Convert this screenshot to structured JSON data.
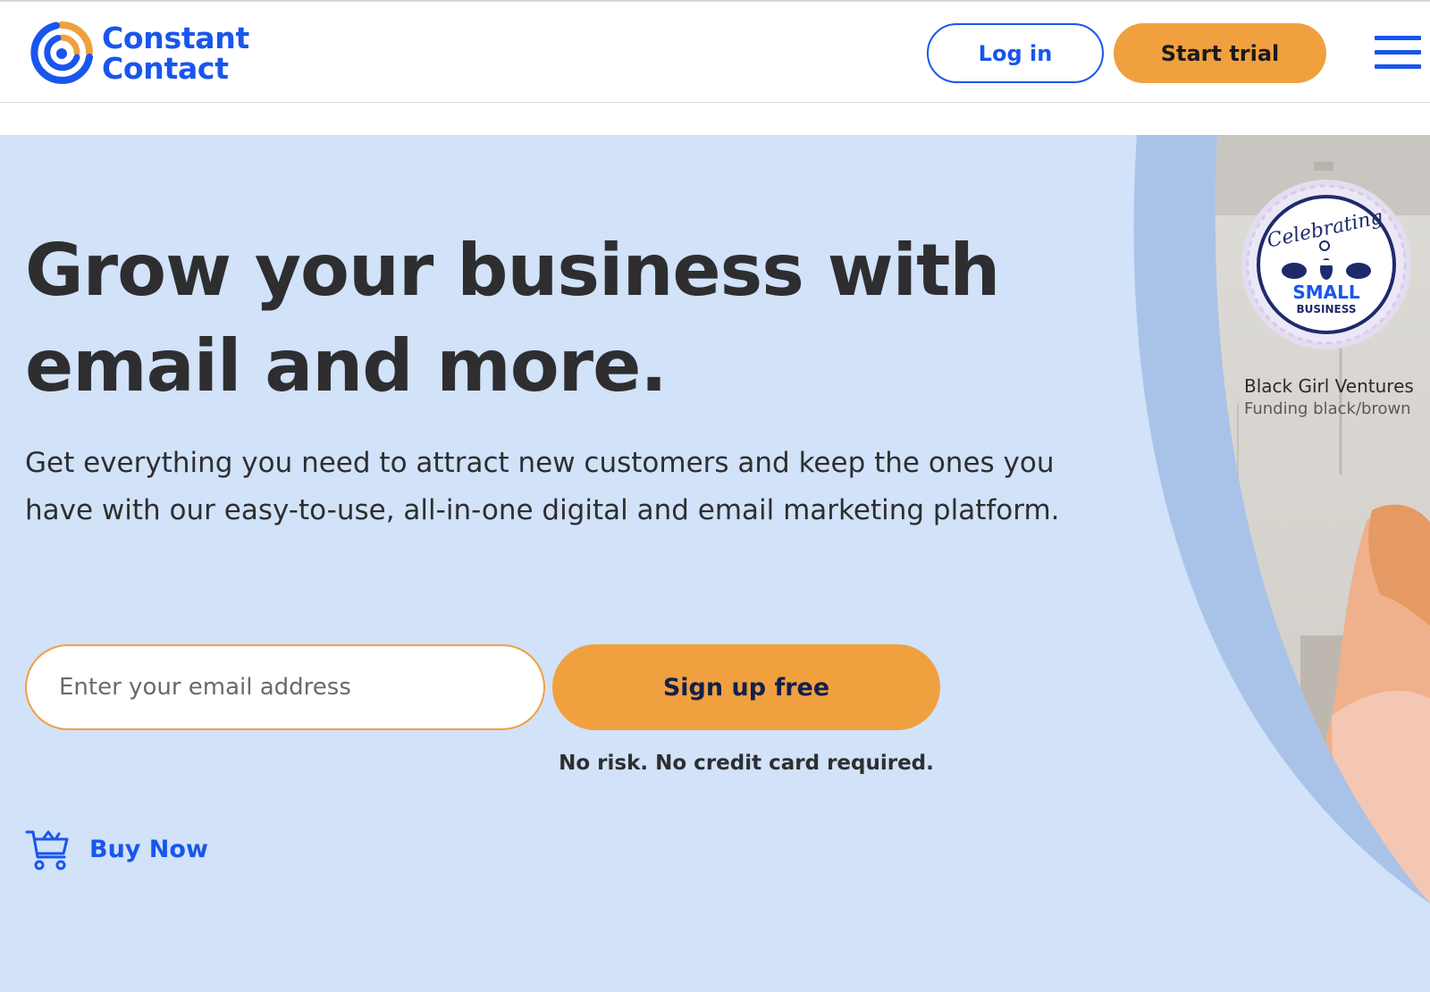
{
  "header": {
    "logo": {
      "line1": "Constant",
      "line2": "Contact"
    },
    "login_label": "Log in",
    "trial_label": "Start trial",
    "menu_icon": "hamburger-menu-icon"
  },
  "hero": {
    "headline": "Grow your business with email and more.",
    "subtext": "Get everything you need to attract new customers and keep the ones you have with our easy-to-use, all-in-one digital and email marketing platform.",
    "email_placeholder": "Enter your email address",
    "signup_label": "Sign up free",
    "disclaimer": "No risk. No credit card required.",
    "buy_now_label": "Buy Now",
    "cart_icon": "shopping-cart-icon",
    "badge": {
      "script_text": "Celebrating",
      "line1": "SMALL",
      "line2": "BUSINESS"
    },
    "photo_caption": {
      "title": "Black Girl Ventures",
      "subtitle": "Funding black/brown"
    }
  },
  "colors": {
    "brand_blue": "#1856ED",
    "accent_orange": "#F0A03F",
    "hero_background": "#D1E2F9",
    "text_dark": "#2E2E30"
  }
}
